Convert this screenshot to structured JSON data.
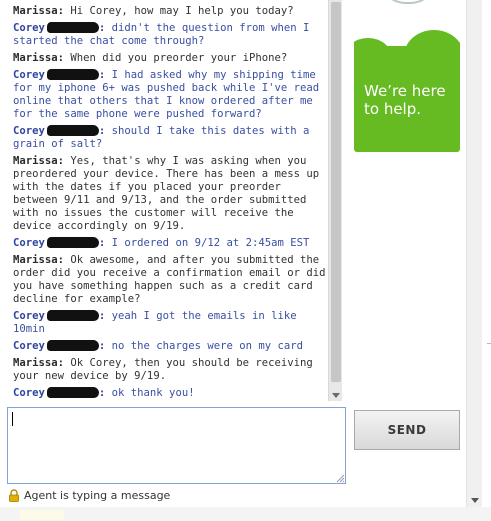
{
  "chat": {
    "messages": [
      {
        "speaker": "Marissa:",
        "role": "agent",
        "text": " Hi Corey, how may I help you today?"
      },
      {
        "speaker": "Corey",
        "role": "visitor",
        "text": " didn't the question from when I started the chat come through?"
      },
      {
        "speaker": "Marissa:",
        "role": "agent",
        "text": " When did you preorder your iPhone?"
      },
      {
        "speaker": "Corey",
        "role": "visitor",
        "text": " I had asked why my shipping time for my iphone 6+ was pushed back while I've read online that others that I know ordered after me for the same phone were pushed forward?"
      },
      {
        "speaker": "Corey",
        "role": "visitor",
        "text": " should I take this dates with a grain of salt?"
      },
      {
        "speaker": "Marissa:",
        "role": "agent",
        "text": " Yes, that's why I was asking when you preordered your device. There has been a mess up with the dates if you placed your preorder between 9/11 and 9/13, and the order submitted with no issues the customer will receive the device accordingly on 9/19."
      },
      {
        "speaker": "Corey",
        "role": "visitor",
        "text": " I ordered on 9/12 at 2:45am EST"
      },
      {
        "speaker": "Marissa:",
        "role": "agent",
        "text": " Ok awesome, and after you submitted the order did you receive a confirmation email or did you have something happen such as a credit card decline for example?"
      },
      {
        "speaker": "Corey",
        "role": "visitor",
        "text": " yeah I got the emails in like 10min"
      },
      {
        "speaker": "Corey",
        "role": "visitor",
        "text": " no the charges were on my card"
      },
      {
        "speaker": "Marissa:",
        "role": "agent",
        "text": " Ok Corey, then you should be receiving your new device by 9/19."
      },
      {
        "speaker": "Corey",
        "role": "visitor",
        "text": " ok thank you!"
      }
    ]
  },
  "ad": {
    "text": "We’re here to help.",
    "color": "#66bb22"
  },
  "composer": {
    "value": "",
    "send_label": "SEND"
  },
  "status": {
    "typing": "Agent is typing a message",
    "icon": "lock-icon"
  }
}
